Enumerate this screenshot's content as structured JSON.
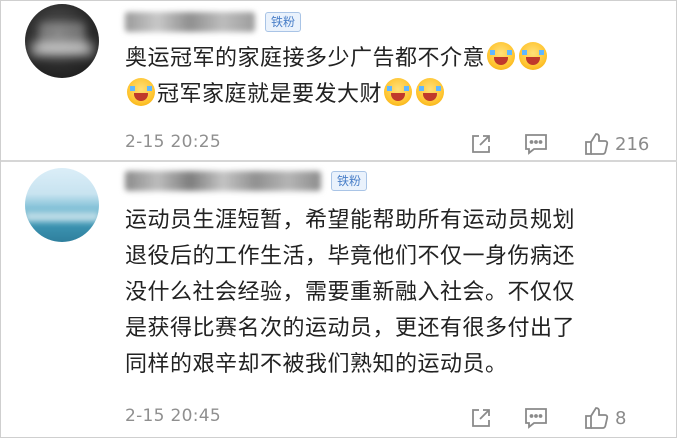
{
  "comments": [
    {
      "badge": "铁粉",
      "line1": "奥运冠军的家庭接多少广告都不介意",
      "line2": "冠军家庭就是要发大财",
      "time": "2-15 20:25",
      "likes": "216",
      "avatar_icon": "blurred-avatar",
      "emoji_icon": "laughing-tears-emoji"
    },
    {
      "badge": "铁粉",
      "lines": [
        "运动员生涯短暂，希望能帮助所有运动员规划",
        "退役后的工作生活，毕竟他们不仅一身伤病还",
        "没什么社会经验，需要重新融入社会。不仅仅",
        "是获得比赛名次的运动员，更还有很多付出了",
        "同样的艰辛却不被我们熟知的运动员。"
      ],
      "time": "2-15 20:45",
      "likes": "8",
      "avatar_icon": "blurred-sea-avatar"
    }
  ],
  "colors": {
    "badge_text": "#4a7fc8",
    "meta_text": "#8f8f8f",
    "content_text": "#222222"
  }
}
